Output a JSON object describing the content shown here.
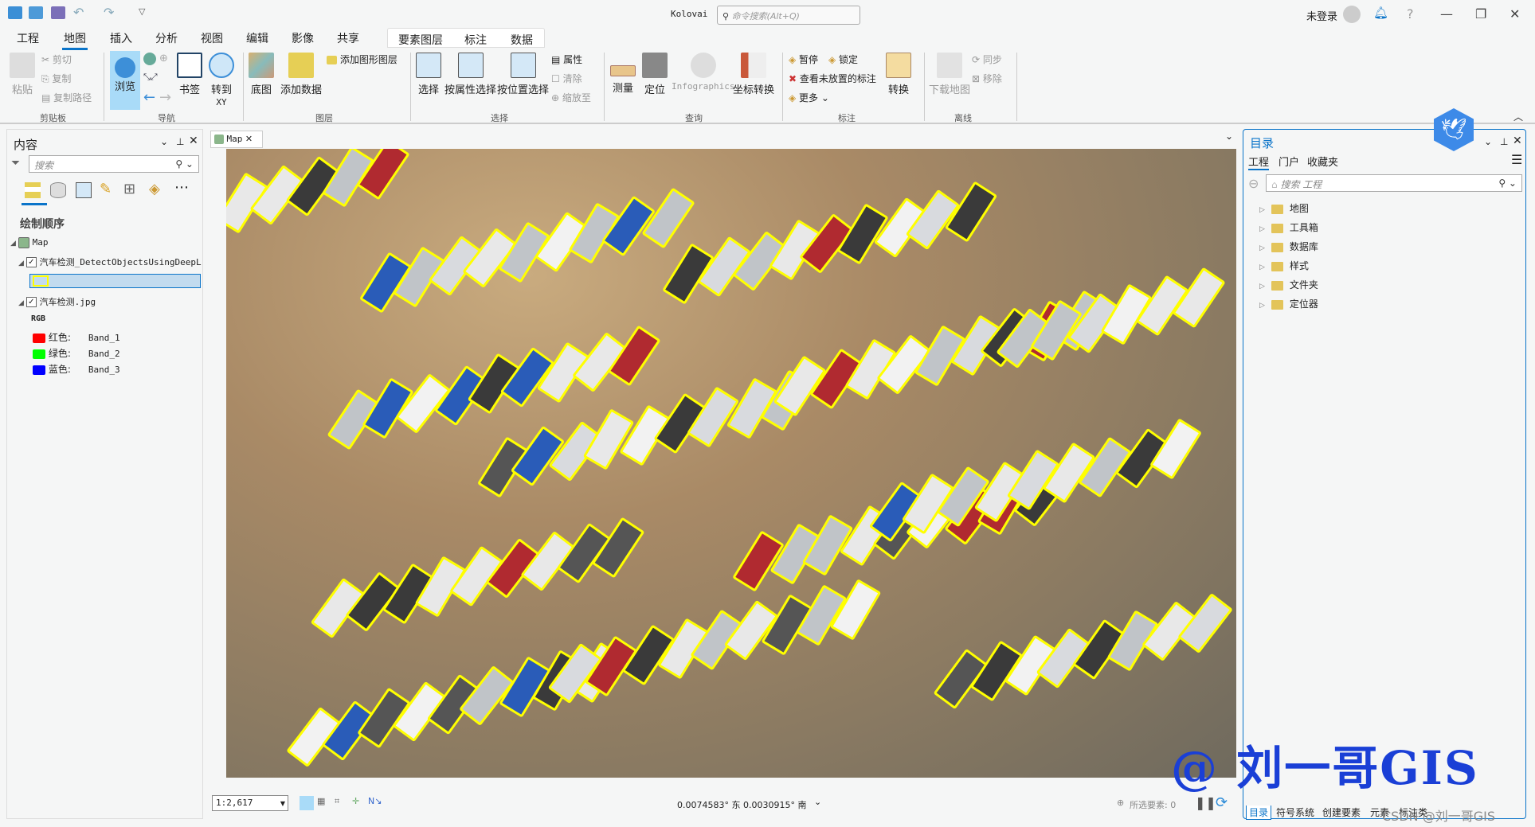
{
  "title_bar": {
    "app_name": "Kolovai",
    "search_placeholder": "命令搜索(Alt+Q)",
    "user": "未登录",
    "help": "?"
  },
  "ribbon_tabs": [
    {
      "label": "工程"
    },
    {
      "label": "地图",
      "active": true
    },
    {
      "label": "插入"
    },
    {
      "label": "分析"
    },
    {
      "label": "视图"
    },
    {
      "label": "编辑"
    },
    {
      "label": "影像"
    },
    {
      "label": "共享"
    }
  ],
  "context_tabs": [
    {
      "label": "要素图层"
    },
    {
      "label": "标注"
    },
    {
      "label": "数据"
    }
  ],
  "ribbon": {
    "clipboard": {
      "paste": "粘贴",
      "cut": "剪切",
      "copy": "复制",
      "copy_path": "复制路径",
      "group": "剪贴板"
    },
    "navigate": {
      "explore": "浏览",
      "bookmarks": "书签",
      "goto_xy": "转到",
      "goto_xy_sub": "XY",
      "group": "导航"
    },
    "layer": {
      "basemap": "底图",
      "add_data": "添加数据",
      "add_graphics": "添加图形图层",
      "group": "图层"
    },
    "selection": {
      "select": "选择",
      "by_attr": "按属性选择",
      "by_loc": "按位置选择",
      "attributes": "属性",
      "clear": "清除",
      "zoom_to": "缩放至",
      "group": "选择"
    },
    "inquiry": {
      "measure": "测量",
      "locate": "定位",
      "infographics": "Infographics",
      "convert_coords": "坐标转换",
      "group": "查询"
    },
    "labeling": {
      "pause": "暂停",
      "lock": "锁定",
      "view_unplaced": "查看未放置的标注",
      "more": "更多",
      "convert": "转换",
      "group": "标注"
    },
    "offline": {
      "download": "下载地图",
      "sync": "同步",
      "remove": "移除",
      "group": "离线"
    }
  },
  "contents": {
    "title": "内容",
    "search_placeholder": "搜索",
    "drawing_order": "绘制顺序",
    "map": "Map",
    "layers": [
      {
        "name": "汽车检测_DetectObjectsUsingDeepL",
        "checked": true
      },
      {
        "name": "汽车检测.jpg",
        "checked": true
      }
    ],
    "rgb_label": "RGB",
    "bands": [
      {
        "label": "红色:",
        "band": "Band_1",
        "color": "#ff0000"
      },
      {
        "label": "绿色:",
        "band": "Band_2",
        "color": "#00ff00"
      },
      {
        "label": "蓝色:",
        "band": "Band_3",
        "color": "#0000ff"
      }
    ]
  },
  "map_view": {
    "tab": "Map",
    "scale": "1:2,617",
    "coords": "0.0074583° 东 0.0030915° 南",
    "selected_features": "所选要素: 0",
    "box_color": "#ffff00"
  },
  "catalog": {
    "title": "目录",
    "tabs": [
      "工程",
      "门户",
      "收藏夹"
    ],
    "search_placeholder": "搜索 工程",
    "items": [
      {
        "label": "地图"
      },
      {
        "label": "工具箱"
      },
      {
        "label": "数据库"
      },
      {
        "label": "样式"
      },
      {
        "label": "文件夹"
      },
      {
        "label": "定位器"
      }
    ]
  },
  "bottom_tabs": [
    "目录",
    "符号系统",
    "创建要素",
    "元素",
    "标注类"
  ],
  "watermark": "@ 刘一哥GIS",
  "csdn_watermark": "CSDN @刘一哥GIS"
}
